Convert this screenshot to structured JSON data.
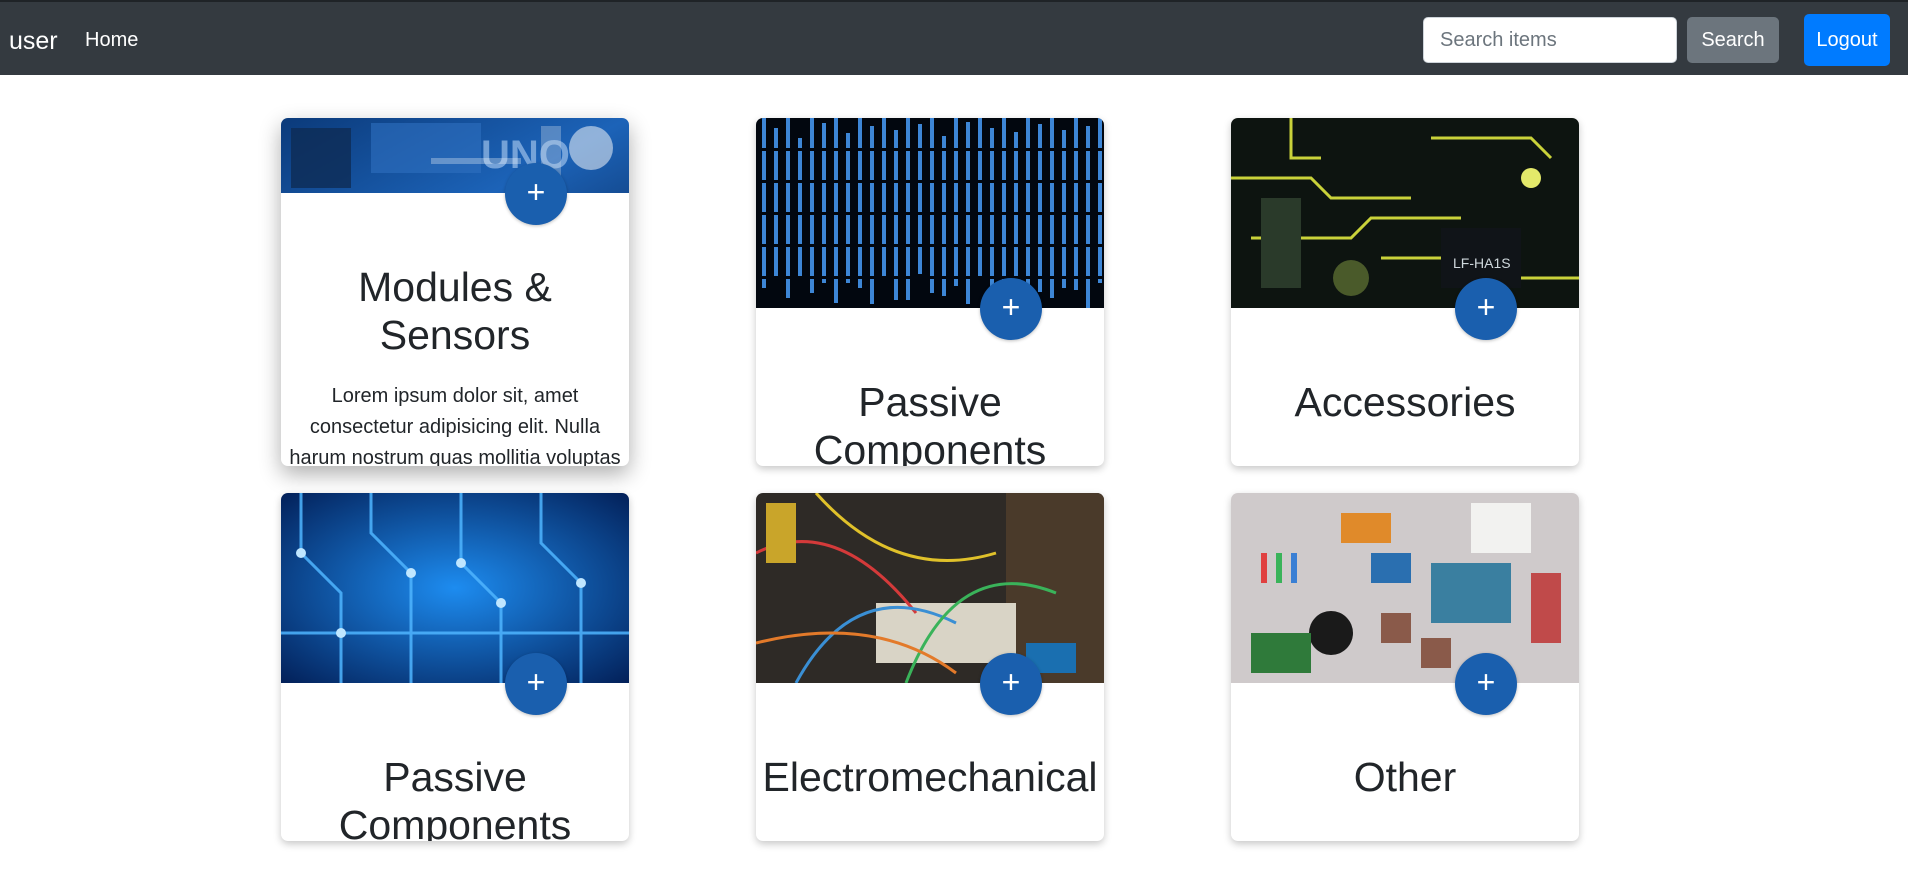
{
  "navbar": {
    "brand": "user",
    "home_label": "Home",
    "search_placeholder": "Search items",
    "search_button": "Search",
    "logout_button": "Logout",
    "colors": {
      "background": "#343a40",
      "search_button": "#6c757d",
      "logout_button": "#007bff"
    }
  },
  "cards": [
    {
      "title": "Modules & Sensors",
      "text": "Lorem ipsum dolor sit, amet consectetur adipisicing elit. Nulla harum nostrum quas mollitia voluptas",
      "add_label": "+",
      "image": "arduino-board-photo"
    },
    {
      "title": "Passive Components",
      "add_label": "+",
      "image": "binary-code-matrix-photo"
    },
    {
      "title": "Accessories",
      "add_label": "+",
      "image": "circuit-board-closeup-photo"
    },
    {
      "title": "Passive Components",
      "add_label": "+",
      "image": "blue-circuit-traces-photo"
    },
    {
      "title": "Electromechanical",
      "add_label": "+",
      "image": "wires-breadboard-photo"
    },
    {
      "title": "Other",
      "add_label": "+",
      "image": "electronic-parts-flatlay-photo"
    }
  ],
  "colors": {
    "add_button": "#1a5fae",
    "title_text": "#212529"
  }
}
